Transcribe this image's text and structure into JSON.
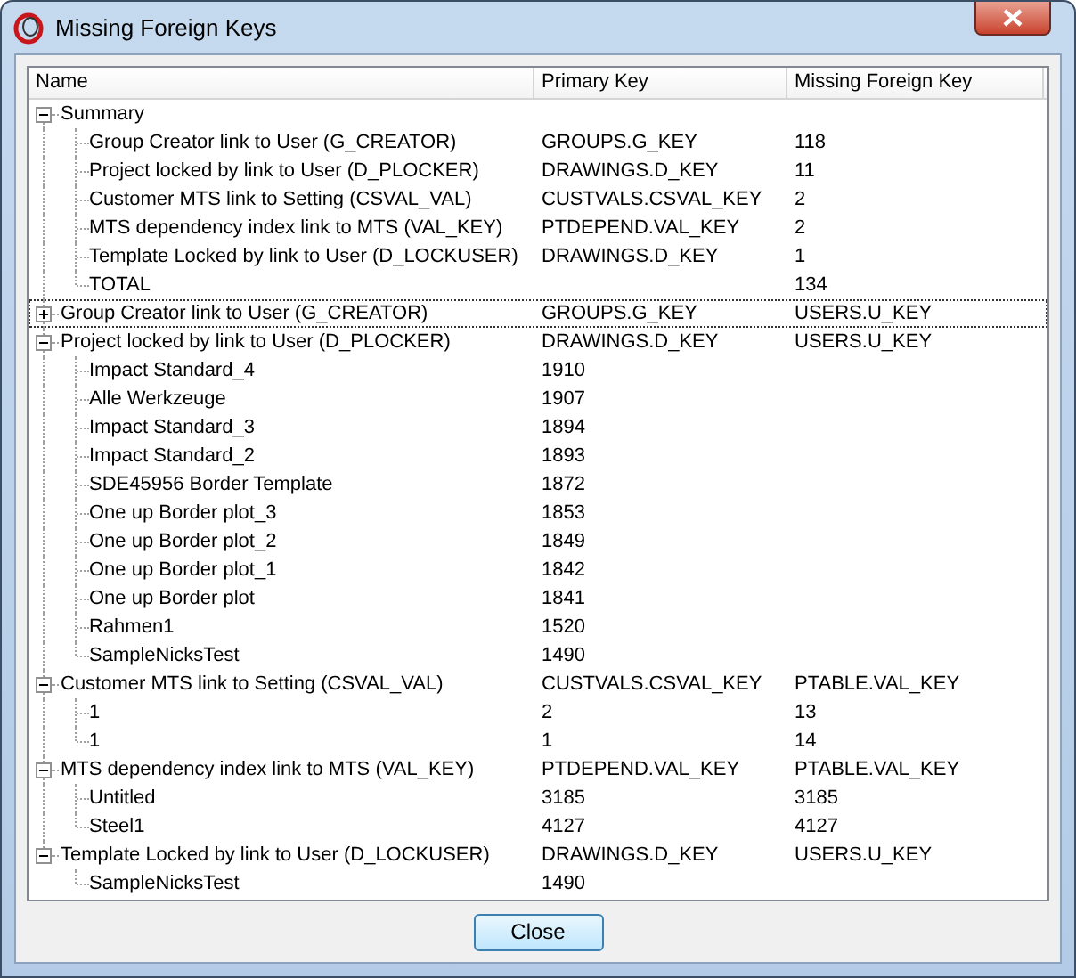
{
  "window": {
    "title": "Missing Foreign Keys"
  },
  "columns": [
    "Name",
    "Primary Key",
    "Missing Foreign Key"
  ],
  "rows": [
    {
      "name": "Summary",
      "expanded": true,
      "focused": false,
      "children": [
        {
          "name": "Group Creator link to User (G_CREATOR)",
          "primary_key": "GROUPS.G_KEY",
          "missing_key": "118"
        },
        {
          "name": "Project locked by link to User (D_PLOCKER)",
          "primary_key": "DRAWINGS.D_KEY",
          "missing_key": "11"
        },
        {
          "name": "Customer MTS link to Setting (CSVAL_VAL)",
          "primary_key": "CUSTVALS.CSVAL_KEY",
          "missing_key": "2"
        },
        {
          "name": "MTS dependency index link to MTS (VAL_KEY)",
          "primary_key": "PTDEPEND.VAL_KEY",
          "missing_key": "2"
        },
        {
          "name": "Template Locked by link to User (D_LOCKUSER)",
          "primary_key": "DRAWINGS.D_KEY",
          "missing_key": "1"
        },
        {
          "name": "TOTAL",
          "missing_key": "134"
        }
      ]
    },
    {
      "name": "Group Creator link to User (G_CREATOR)",
      "primary_key": "GROUPS.G_KEY",
      "missing_key": "USERS.U_KEY",
      "expanded": false,
      "focused": true
    },
    {
      "name": "Project locked by link to User (D_PLOCKER)",
      "primary_key": "DRAWINGS.D_KEY",
      "missing_key": "USERS.U_KEY",
      "expanded": true,
      "focused": false,
      "children": [
        {
          "name": "Impact Standard_4",
          "primary_key": "1910"
        },
        {
          "name": "Alle Werkzeuge",
          "primary_key": "1907"
        },
        {
          "name": "Impact Standard_3",
          "primary_key": "1894"
        },
        {
          "name": "Impact Standard_2",
          "primary_key": "1893"
        },
        {
          "name": "SDE45956 Border Template",
          "primary_key": "1872"
        },
        {
          "name": "One up Border plot_3",
          "primary_key": "1853"
        },
        {
          "name": "One up Border plot_2",
          "primary_key": "1849"
        },
        {
          "name": "One up Border plot_1",
          "primary_key": "1842"
        },
        {
          "name": "One up Border plot",
          "primary_key": "1841"
        },
        {
          "name": "Rahmen1",
          "primary_key": "1520"
        },
        {
          "name": "SampleNicksTest",
          "primary_key": "1490"
        }
      ]
    },
    {
      "name": "Customer MTS link to Setting (CSVAL_VAL)",
      "primary_key": "CUSTVALS.CSVAL_KEY",
      "missing_key": "PTABLE.VAL_KEY",
      "expanded": true,
      "focused": false,
      "children": [
        {
          "name": "1",
          "primary_key": "2",
          "missing_key": "13"
        },
        {
          "name": "1",
          "primary_key": "1",
          "missing_key": "14"
        }
      ]
    },
    {
      "name": "MTS dependency index link to MTS (VAL_KEY)",
      "primary_key": "PTDEPEND.VAL_KEY",
      "missing_key": "PTABLE.VAL_KEY",
      "expanded": true,
      "focused": false,
      "children": [
        {
          "name": "Untitled",
          "primary_key": "3185",
          "missing_key": "3185"
        },
        {
          "name": "Steel1",
          "primary_key": "4127",
          "missing_key": "4127"
        }
      ]
    },
    {
      "name": "Template Locked by link to User (D_LOCKUSER)",
      "primary_key": "DRAWINGS.D_KEY",
      "missing_key": "USERS.U_KEY",
      "expanded": true,
      "focused": false,
      "children": [
        {
          "name": "SampleNicksTest",
          "primary_key": "1490"
        }
      ]
    }
  ],
  "buttons": [
    "Close"
  ]
}
